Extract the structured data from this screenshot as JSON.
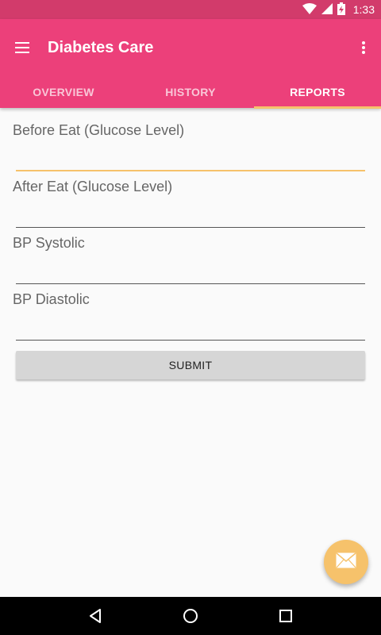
{
  "status_bar": {
    "time": "1:33",
    "icons": [
      "wifi-icon",
      "cell-signal-icon",
      "battery-charging-icon"
    ]
  },
  "app_bar": {
    "title": "Diabetes Care",
    "menu_icon": "hamburger-menu-icon",
    "overflow_icon": "more-vert-icon",
    "background_color": "#ec407a"
  },
  "tabs": [
    {
      "label": "OVERVIEW",
      "active": false
    },
    {
      "label": "HISTORY",
      "active": false
    },
    {
      "label": "REPORTS",
      "active": true
    }
  ],
  "form": {
    "fields": [
      {
        "label": "Before Eat (Glucose Level)",
        "value": ""
      },
      {
        "label": "After Eat (Glucose Level)",
        "value": ""
      },
      {
        "label": "BP Systolic",
        "value": ""
      },
      {
        "label": "BP Diastolic",
        "value": ""
      }
    ],
    "submit_label": "SUBMIT"
  },
  "fab": {
    "icon": "mail-icon",
    "color": "#f6c26b"
  },
  "nav_bar": {
    "icons": [
      "back-icon",
      "home-icon",
      "recents-icon"
    ]
  },
  "accent_color": "#f6c26b"
}
